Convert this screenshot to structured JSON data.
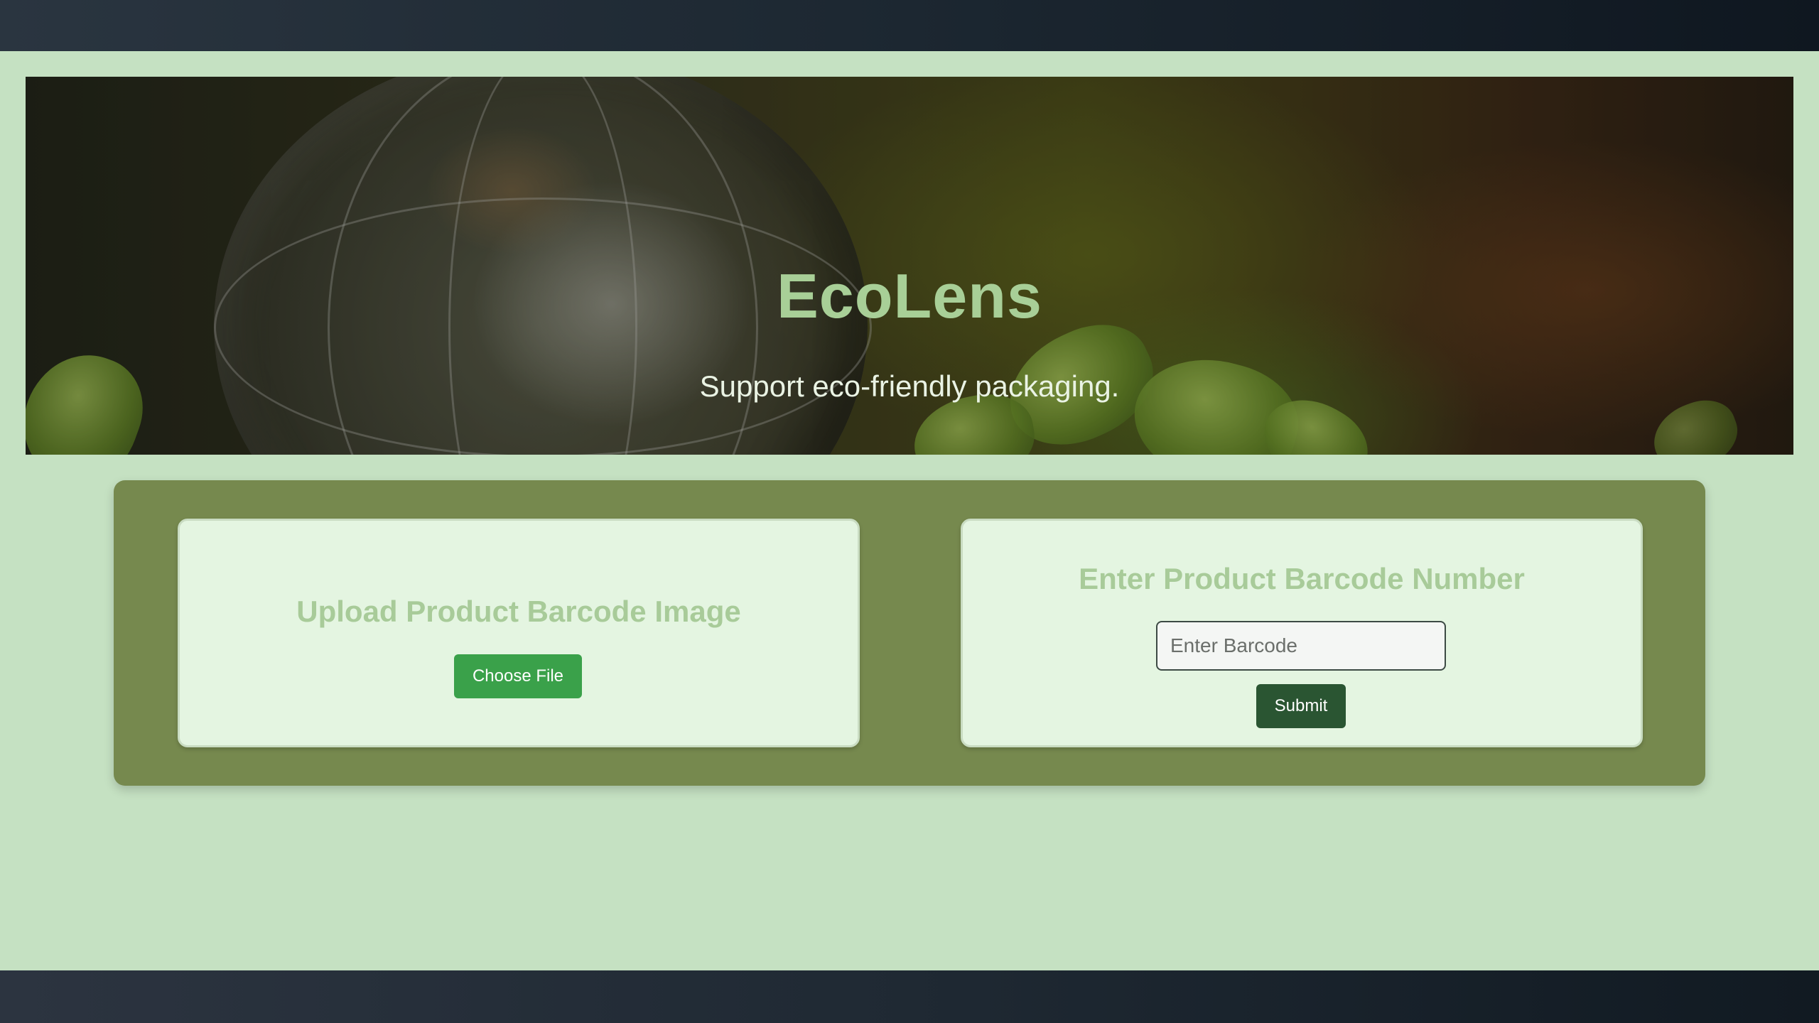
{
  "hero": {
    "title": "EcoLens",
    "subtitle": "Support eco-friendly packaging."
  },
  "upload_card": {
    "heading": "Upload Product Barcode Image",
    "button_label": "Choose File"
  },
  "barcode_card": {
    "heading": "Enter Product Barcode Number",
    "input_placeholder": "Enter Barcode",
    "input_value": "",
    "submit_label": "Submit"
  },
  "colors": {
    "page_background": "#c5e1c2",
    "panel_background": "#76894e",
    "card_background": "#e4f5e1",
    "title_color": "#a8cf97",
    "choose_button": "#3aa14a",
    "submit_button": "#2a5532"
  }
}
